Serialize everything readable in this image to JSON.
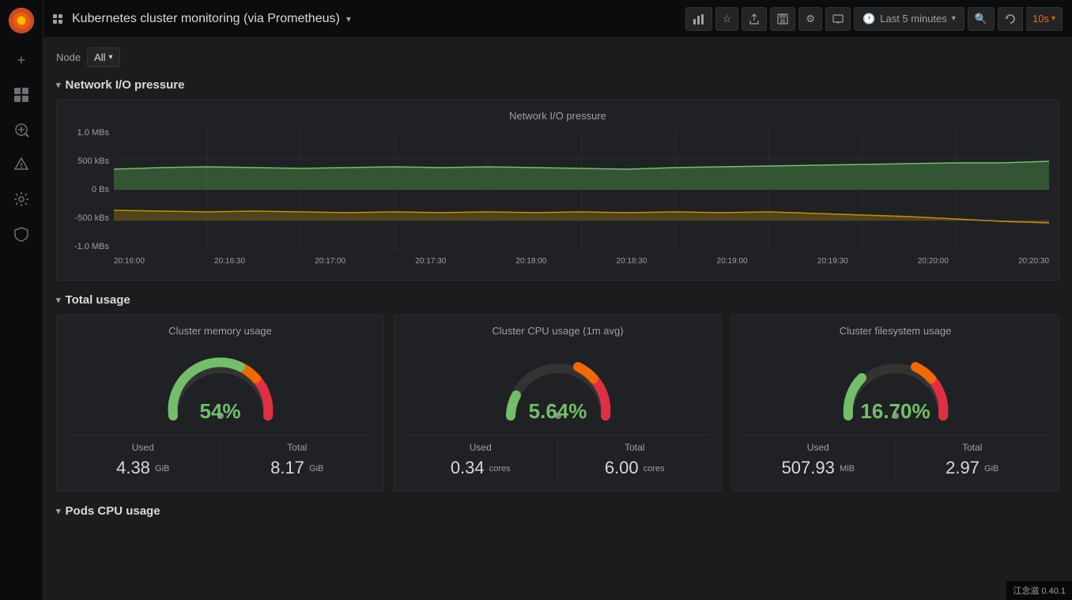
{
  "topbar": {
    "logo_icon": "grafana-logo",
    "title": "Kubernetes cluster monitoring (via Prometheus)",
    "dropdown_icon": "chevron-down",
    "buttons": {
      "graph_icon": "📊",
      "star_icon": "☆",
      "share_icon": "⬆",
      "save_icon": "💾",
      "settings_icon": "⚙",
      "tv_icon": "🖥",
      "time_range": "Last 5 minutes",
      "search_icon": "🔍",
      "refresh_interval": "10s"
    }
  },
  "filters": {
    "node_label": "Node",
    "node_value": "All"
  },
  "network_section": {
    "title": "Network I/O pressure",
    "chart": {
      "title": "Network I/O pressure",
      "y_labels": [
        "1.0 MBs",
        "500 kBs",
        "0 Bs",
        "-500 kBs",
        "-1.0 MBs"
      ],
      "x_labels": [
        "20:16:00",
        "20:16:30",
        "20:17:00",
        "20:17:30",
        "20:18:00",
        "20:18:30",
        "20:19:00",
        "20:19:30",
        "20:20:00",
        "20:20:30"
      ]
    }
  },
  "total_usage_section": {
    "title": "Total usage",
    "panels": [
      {
        "id": "memory",
        "title": "Cluster memory usage",
        "percentage": "54%",
        "percentage_color": "#73bf69",
        "used_label": "Used",
        "used_value": "4.38",
        "used_unit": "GiB",
        "total_label": "Total",
        "total_value": "8.17",
        "total_unit": "GiB",
        "gauge_fill": 54
      },
      {
        "id": "cpu",
        "title": "Cluster CPU usage (1m avg)",
        "percentage": "5.64%",
        "percentage_color": "#73bf69",
        "used_label": "Used",
        "used_value": "0.34",
        "used_unit": "cores",
        "total_label": "Total",
        "total_value": "6.00",
        "total_unit": "cores",
        "gauge_fill": 5.64
      },
      {
        "id": "filesystem",
        "title": "Cluster filesystem usage",
        "percentage": "16.70%",
        "percentage_color": "#73bf69",
        "used_label": "Used",
        "used_value": "507.93",
        "used_unit": "MiB",
        "total_label": "Total",
        "total_value": "2.97",
        "total_unit": "GiB",
        "gauge_fill": 16.7
      }
    ]
  },
  "next_section": {
    "title": "Pods CPU usage"
  },
  "watermark": "江念滋 0.40.1"
}
